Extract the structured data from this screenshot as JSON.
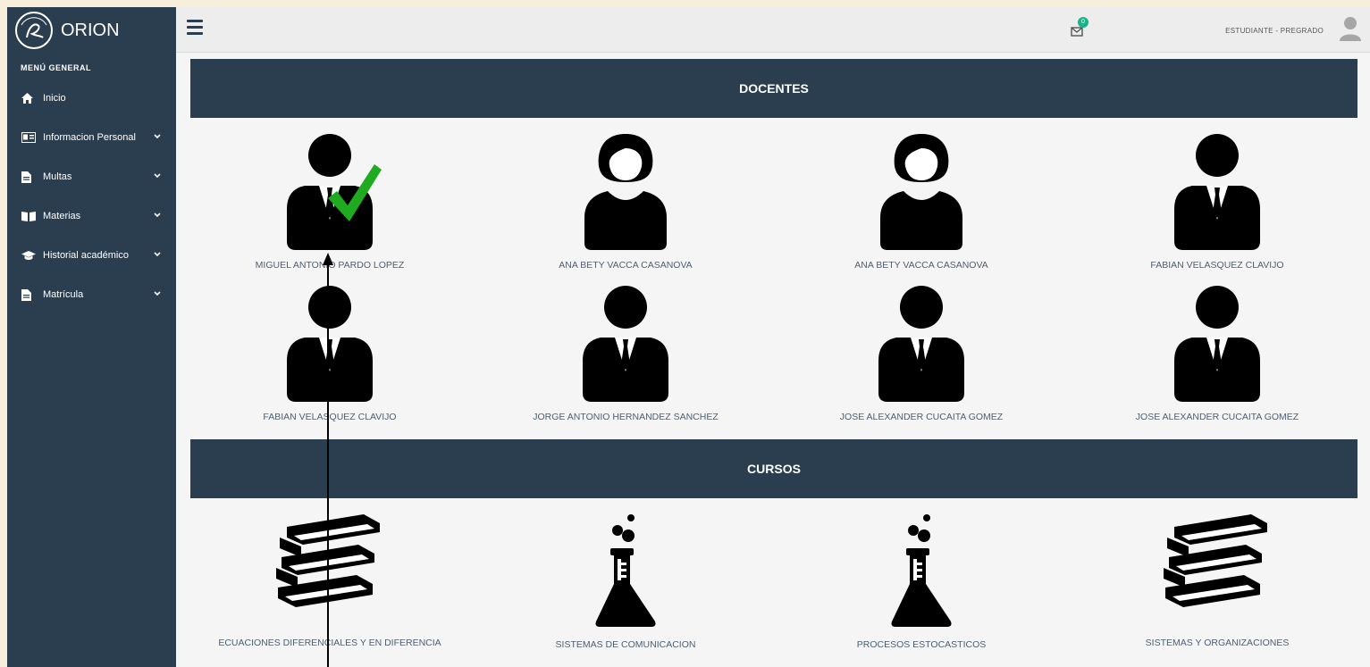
{
  "app": {
    "name": "ORION"
  },
  "sidebar": {
    "menu_title": "MENÚ GENERAL",
    "items": [
      {
        "label": "Inicio",
        "icon": "home-icon",
        "expandable": false
      },
      {
        "label": "Informacion Personal",
        "icon": "id-card-icon",
        "expandable": true
      },
      {
        "label": "Multas",
        "icon": "document-icon",
        "expandable": true
      },
      {
        "label": "Materias",
        "icon": "open-book-icon",
        "expandable": true
      },
      {
        "label": "Historial académico",
        "icon": "graduation-cap-icon",
        "expandable": true
      },
      {
        "label": "Matrícula",
        "icon": "document-icon",
        "expandable": true
      }
    ]
  },
  "header": {
    "notification_count": "0",
    "role": "ESTUDIANTE - PREGRADO"
  },
  "docentes": {
    "title": "DOCENTES",
    "items": [
      {
        "name": "MIGUEL ANTONIO PARDO LOPEZ",
        "avatar": "man-icon",
        "checked": true
      },
      {
        "name": "ANA BETY VACCA CASANOVA",
        "avatar": "woman-icon",
        "checked": false
      },
      {
        "name": "ANA BETY VACCA CASANOVA",
        "avatar": "woman-icon",
        "checked": false
      },
      {
        "name": "FABIAN VELASQUEZ CLAVIJO",
        "avatar": "man-icon",
        "checked": false
      },
      {
        "name": "FABIAN VELASQUEZ CLAVIJO",
        "avatar": "man-icon",
        "checked": false
      },
      {
        "name": "JORGE ANTONIO HERNANDEZ SANCHEZ",
        "avatar": "man-icon",
        "checked": false
      },
      {
        "name": "JOSE ALEXANDER CUCAITA GOMEZ",
        "avatar": "man-icon",
        "checked": false
      },
      {
        "name": "JOSE ALEXANDER CUCAITA GOMEZ",
        "avatar": "man-icon",
        "checked": false
      }
    ]
  },
  "cursos": {
    "title": "CURSOS",
    "items": [
      {
        "name": "ECUACIONES DIFERENCIALES Y EN DIFERENCIA",
        "icon": "books-icon"
      },
      {
        "name": "SISTEMAS DE COMUNICACION",
        "icon": "flask-icon"
      },
      {
        "name": "PROCESOS ESTOCASTICOS",
        "icon": "flask-icon"
      },
      {
        "name": "SISTEMAS Y ORGANIZACIONES",
        "icon": "books-icon"
      }
    ]
  },
  "colors": {
    "sidebar": "#2b3e50",
    "content_bg": "#f5f5f5",
    "label_text": "#4d5f74",
    "check": "#1faa1f",
    "badge": "#1bb38a"
  }
}
